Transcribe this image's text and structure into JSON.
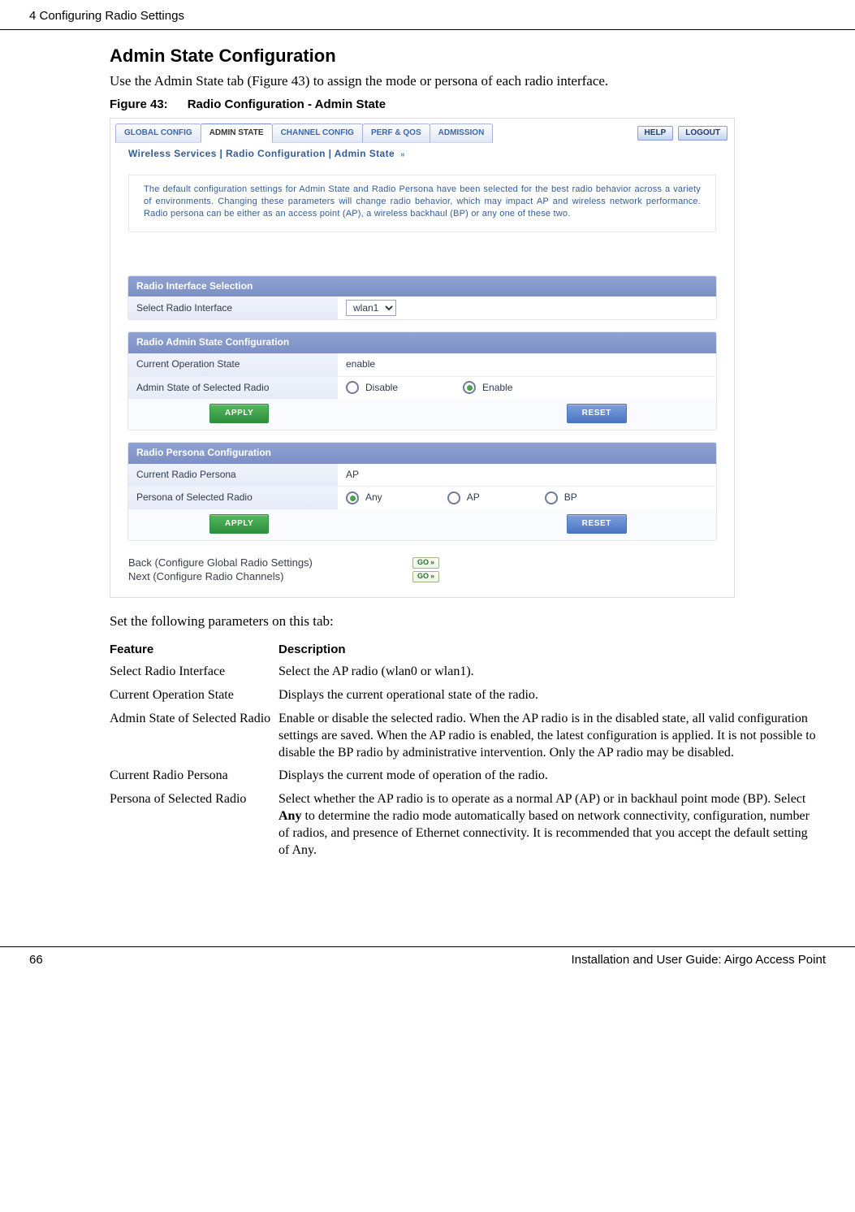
{
  "header": {
    "chapter": "4  Configuring Radio Settings"
  },
  "section": {
    "title": "Admin State Configuration",
    "intro": "Use the Admin State tab (Figure 43) to assign the mode or persona of each radio interface.",
    "fig_num": "Figure 43:",
    "fig_title": "Radio Configuration - Admin State",
    "after_fig": "Set the following parameters on this tab:"
  },
  "ui": {
    "tabs": {
      "global": "GLOBAL CONFIG",
      "admin": "ADMIN STATE",
      "channel": "CHANNEL CONFIG",
      "perf": "PERF & QOS",
      "admission": "ADMISSION"
    },
    "help": "HELP",
    "logout": "LOGOUT",
    "breadcrumb": "Wireless Services | Radio Configuration | Admin State",
    "intro_box": "The default configuration settings for Admin State and Radio Persona have been selected for the best radio behavior across a variety of environments. Changing these parameters will change radio behavior, which may impact AP and wireless network performance. Radio persona can be either as an access point (AP), a wireless backhaul (BP) or any one of these two.",
    "p1": {
      "head": "Radio Interface Selection",
      "row1": "Select Radio Interface",
      "sel_value": "wlan1"
    },
    "p2": {
      "head": "Radio Admin State Configuration",
      "row1": "Current Operation State",
      "row1_val": "enable",
      "row2": "Admin State of Selected Radio",
      "opt_disable": "Disable",
      "opt_enable": "Enable"
    },
    "p3": {
      "head": "Radio Persona Configuration",
      "row1": "Current Radio Persona",
      "row1_val": "AP",
      "row2": "Persona of Selected Radio",
      "opt_any": "Any",
      "opt_ap": "AP",
      "opt_bp": "BP"
    },
    "buttons": {
      "apply": "APPLY",
      "reset": "RESET"
    },
    "nav": {
      "back": "Back (Configure Global Radio Settings)",
      "next": "Next (Configure Radio Channels)",
      "go": "GO"
    }
  },
  "table": {
    "head_feature": "Feature",
    "head_desc": "Description",
    "rows": [
      {
        "f": "Select Radio Interface",
        "d": "Select the AP radio (wlan0 or wlan1)."
      },
      {
        "f": "Current Operation State",
        "d": "Displays the current operational state of the radio."
      },
      {
        "f": "Admin State of Selected Radio",
        "d": "Enable or disable the selected radio. When the AP radio is in the disabled state, all valid configuration settings are saved. When the AP radio is enabled, the latest configuration is applied. It is not possible to disable the BP radio by administrative intervention. Only the AP radio may be disabled."
      },
      {
        "f": "Current Radio Persona",
        "d": "Displays the current mode of operation of the radio."
      },
      {
        "f": "Persona of Selected Radio",
        "d": "Select whether the AP radio is to operate as a normal AP (AP) or in backhaul point mode (BP). Select Any to determine the radio mode automatically based on network connectivity, configuration, number of radios, and presence of Ethernet connectivity. It is recommended that you accept the default setting of Any."
      }
    ]
  },
  "footer": {
    "pagenum": "66",
    "title": "Installation and User Guide: Airgo Access Point"
  }
}
